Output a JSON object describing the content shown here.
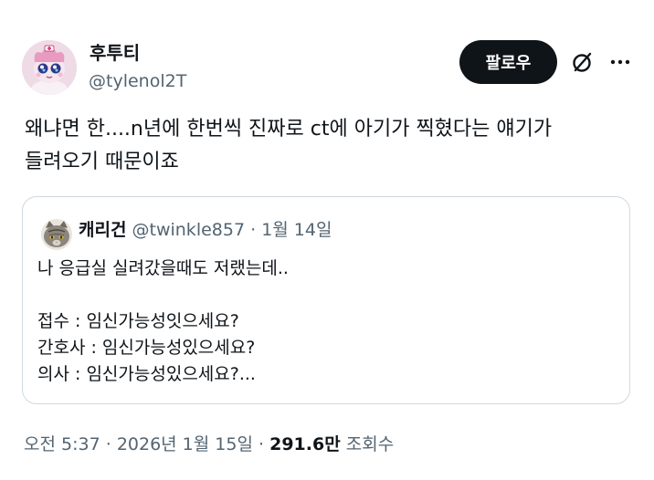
{
  "tweet": {
    "author": {
      "display_name": "후투티",
      "handle": "@tylenol2T"
    },
    "follow_label": "팔로우",
    "grok_icon": "grok-slash-circle-icon",
    "more_icon": "more-horizontal-icon",
    "text": "왜냐면 한....n년에 한번씩 진짜로 ct에 아기가 찍혔다는 얘기가\n들려오기 때문이죠",
    "quote": {
      "author": {
        "display_name": "캐리건",
        "handle": "@twinkle857"
      },
      "separator": "·",
      "date": "1월 14일",
      "text": "나 응급실 실려갔을때도 저랬는데..\n\n접수 : 임신가능성잇으세요?\n간호사 : 임신가능성있으세요?\n의사 : 임신가능성있으세요?..."
    },
    "meta": {
      "time": "오전 5:37",
      "separator": "·",
      "date": "2026년 1월 15일",
      "views_count": "291.6만",
      "views_label": "조회수"
    }
  },
  "colors": {
    "text_primary": "#0f1419",
    "text_secondary": "#536471",
    "border": "#cfd9de",
    "button_bg": "#0f1419"
  }
}
